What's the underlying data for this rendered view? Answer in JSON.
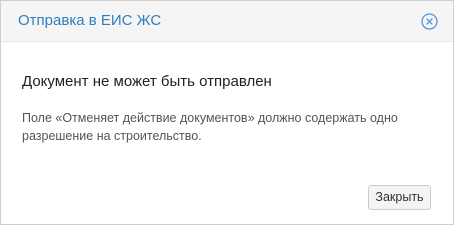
{
  "dialog": {
    "title": "Отправка в ЕИС ЖС",
    "close_icon": "close-circle-icon",
    "heading": "Документ не может быть отправлен",
    "body": "Поле «Отменяет действие документов» должно содержать одно разрешение на строительство.",
    "close_button_label": "Закрыть",
    "colors": {
      "title": "#2f7fc1",
      "header_background": "#f5f5f5",
      "close_icon": "#4a90d9"
    }
  }
}
